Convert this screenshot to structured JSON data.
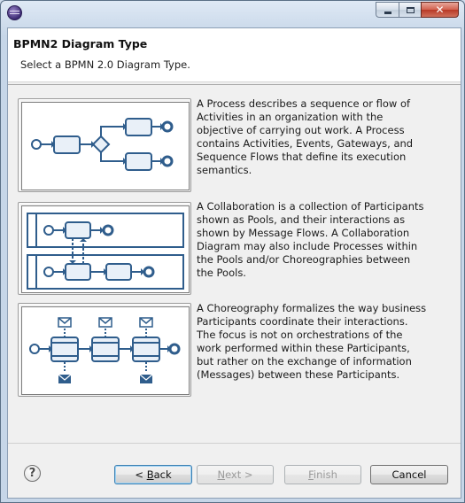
{
  "window": {
    "title": "",
    "icon": "eclipse-icon"
  },
  "banner": {
    "title": "BPMN2 Diagram Type",
    "description": "Select a BPMN 2.0 Diagram Type."
  },
  "options": [
    {
      "name": "process",
      "icon": "process-diagram-icon",
      "description": "A Process describes a sequence or flow of Activities in an organization with the objective of carrying out work. A Process contains Activities, Events, Gateways, and Sequence Flows that define its execution semantics."
    },
    {
      "name": "collaboration",
      "icon": "collaboration-diagram-icon",
      "description": "A Collaboration is a collection of Participants shown as Pools, and their interactions as shown by Message Flows. A Collaboration Diagram may also include Processes within the Pools and/or Choreographies between the Pools."
    },
    {
      "name": "choreography",
      "icon": "choreography-diagram-icon",
      "description": "A Choreography formalizes the way business Participants coordinate their interactions. The focus is not on orchestrations of the work performed within these Participants, but rather on the exchange of information (Messages) between these Participants."
    }
  ],
  "buttons": {
    "back_prefix": "< ",
    "back_accel": "B",
    "back_rest": "ack",
    "next_accel": "N",
    "next_rest": "ext >",
    "finish_accel": "F",
    "finish_rest": "inish",
    "cancel": "Cancel"
  },
  "colors": {
    "diagram_stroke": "#2f5d8c",
    "diagram_fill": "#e9f0f8"
  }
}
